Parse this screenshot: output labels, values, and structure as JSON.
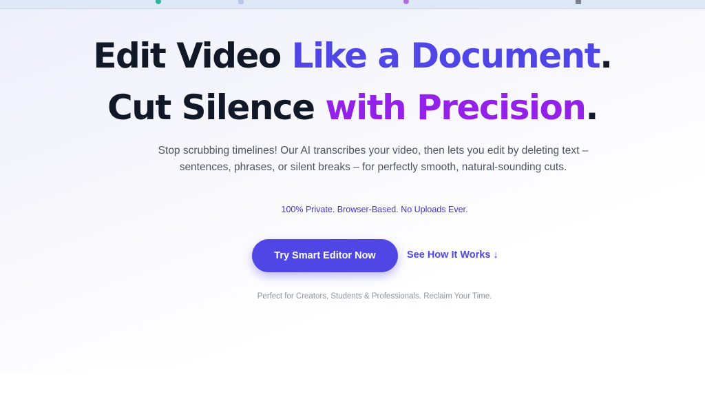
{
  "hero": {
    "headline_line1": {
      "part1": "Edit Video ",
      "part2": "Like a Document",
      "part3": "."
    },
    "headline_line2": {
      "part1": "Cut Silence ",
      "part2": "with Precision",
      "part3": "."
    },
    "subtitle": "Stop scrubbing timelines! Our AI transcribes your video, then lets you edit by deleting text – sentences, phrases, or silent breaks – for perfectly smooth, natural-sounding cuts.",
    "privacy_note": "100% Private. Browser-Based. No Uploads Ever.",
    "primary_cta": "Try Smart Editor Now",
    "secondary_cta": "See How It Works ↓",
    "tagline": "Perfect for Creators, Students & Professionals. Reclaim Your Time."
  },
  "colors": {
    "accent_blue": "#4f46e5",
    "accent_purple": "#9321e8",
    "headline": "#111827",
    "bookmark_bar": "#dfe8f6"
  }
}
